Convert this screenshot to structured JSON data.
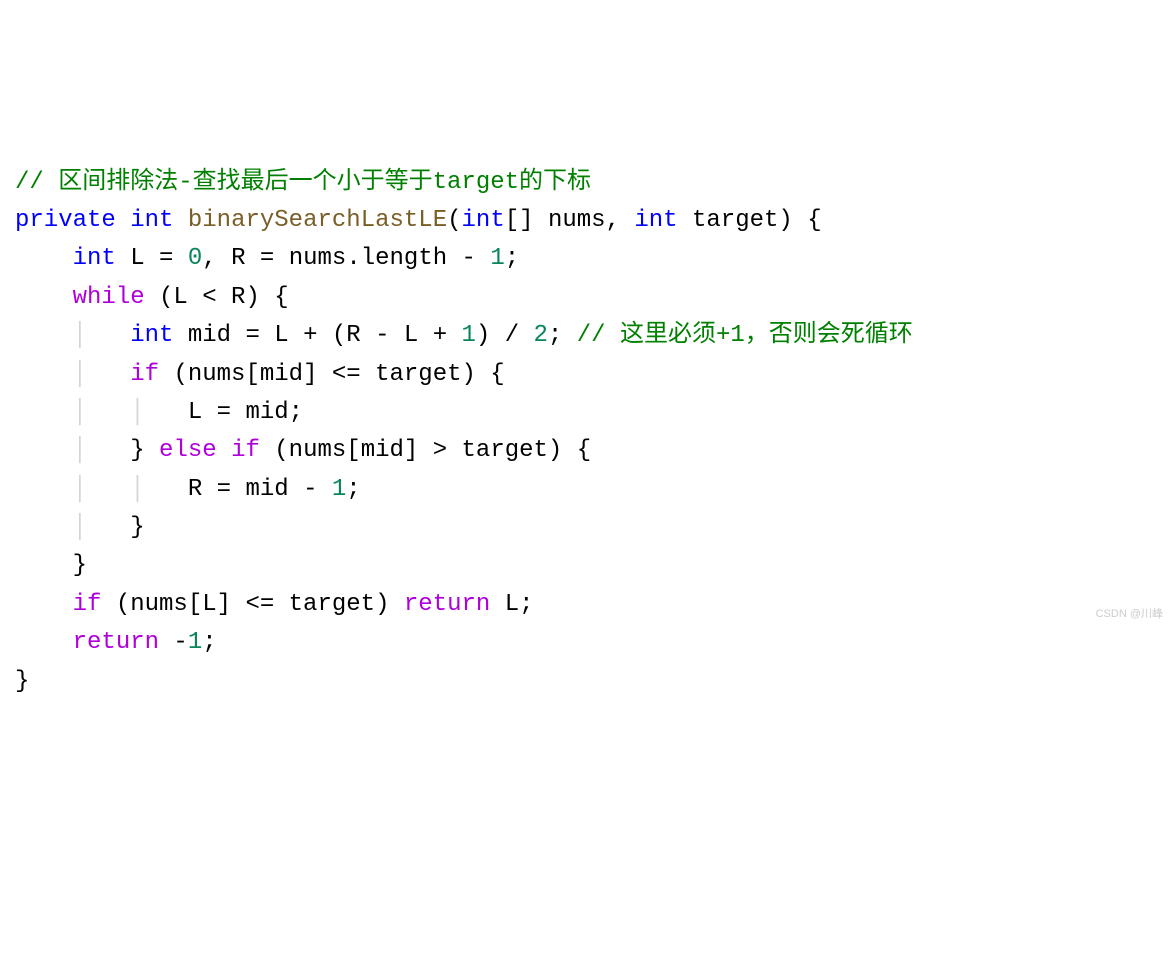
{
  "code": {
    "line1": {
      "comment": "// 区间排除法-查找最后一个小于等于target的下标"
    },
    "line2": {
      "kw_private": "private",
      "kw_int": "int",
      "method": "binarySearchLastLE",
      "lparen": "(",
      "param1_type": "int",
      "brackets": "[]",
      "param1_name": "nums",
      "comma": ",",
      "param2_type": "int",
      "param2_name": "target",
      "rparen": ")",
      "brace": " {"
    },
    "line3": {
      "indent": "    ",
      "kw_int": "int",
      "var_L": "L",
      "eq": " = ",
      "zero": "0",
      "comma": ", ",
      "var_R": "R",
      "eq2": " = ",
      "nums": "nums",
      "dot": ".",
      "length": "length",
      "minus": " - ",
      "one": "1",
      "semi": ";"
    },
    "line4": {
      "indent": "    ",
      "kw_while": "while",
      "condition": " (L < R) {"
    },
    "line5": {
      "indent": "    ",
      "guide": "│",
      "sp": "   ",
      "kw_int": "int",
      "mid": " mid = L + (R - L + ",
      "one1": "1",
      "div": ") / ",
      "two": "2",
      "semi": "; ",
      "comment": "// 这里必须+1，否则会死循环"
    },
    "line6": {
      "indent": "    ",
      "guide": "│",
      "sp": "   ",
      "kw_if": "if",
      "condition": " (nums[mid] <= target) {"
    },
    "line7": {
      "indent": "    ",
      "guide1": "│",
      "sp1": "   ",
      "guide2": "│",
      "sp2": "   ",
      "stmt": "L = mid;"
    },
    "line8": {
      "indent": "    ",
      "guide": "│",
      "sp": "   ",
      "brace": "} ",
      "kw_else": "else",
      "sp2": " ",
      "kw_if": "if",
      "condition": " (nums[mid] > target) {"
    },
    "line9": {
      "indent": "    ",
      "guide1": "│",
      "sp1": "   ",
      "guide2": "│",
      "sp2": "   ",
      "stmt_pre": "R = mid - ",
      "one": "1",
      "semi": ";"
    },
    "line10": {
      "indent": "    ",
      "guide": "│",
      "sp": "   ",
      "brace": "}"
    },
    "line11": {
      "indent": "    ",
      "brace": "}"
    },
    "line12": {
      "indent": "    ",
      "kw_if": "if",
      "condition": " (nums[L] <= target) ",
      "kw_return": "return",
      "val": " L;"
    },
    "line13": {
      "indent": "    ",
      "kw_return": "return",
      "neg": " -",
      "one": "1",
      "semi": ";"
    },
    "line14": {
      "brace": "}"
    }
  },
  "watermark": "CSDN @川峰"
}
